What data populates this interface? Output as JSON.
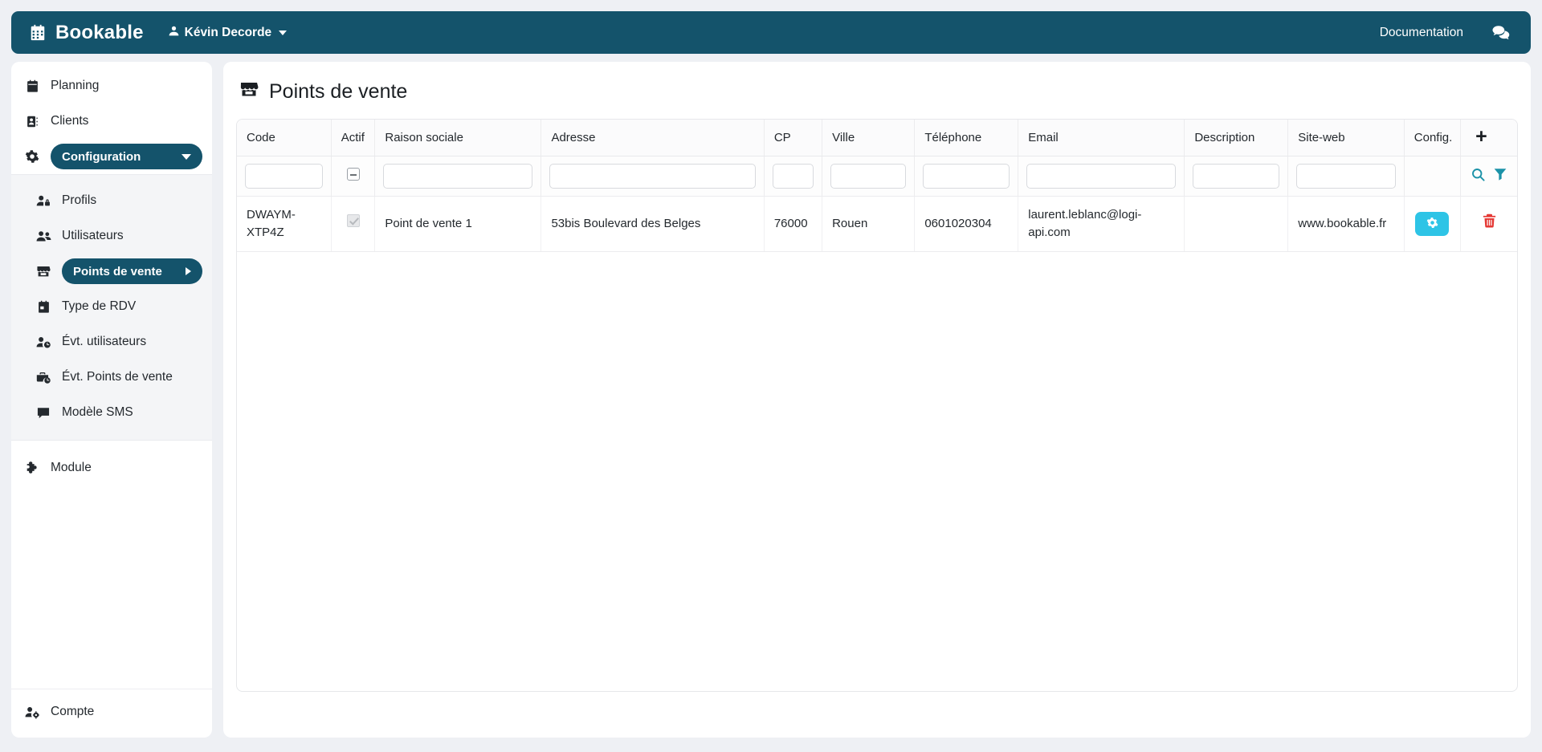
{
  "colors": {
    "brand_dark": "#14536b",
    "accent_cyan": "#2ec4e6",
    "danger_red": "#e53935",
    "page_bg": "#eef0f4",
    "tool_teal": "#1b92a8"
  },
  "navbar": {
    "brand": "Bookable",
    "brand_icon": "calendar-icon",
    "user_name": "Kévin Decorde",
    "user_icon": "user-icon",
    "caret_icon": "caret-down-icon",
    "documentation_label": "Documentation",
    "chat_icon": "chat-bubbles-icon"
  },
  "sidebar": {
    "top_items": [
      {
        "label": "Planning",
        "icon": "calendar-icon",
        "active": false
      },
      {
        "label": "Clients",
        "icon": "contact-card-icon",
        "active": false
      },
      {
        "label": "Configuration",
        "icon": "gear-icon",
        "active": true,
        "expanded": true
      }
    ],
    "submenu_items": [
      {
        "label": "Profils",
        "icon": "user-lock-icon",
        "active": false
      },
      {
        "label": "Utilisateurs",
        "icon": "users-icon",
        "active": false
      },
      {
        "label": "Points de vente",
        "icon": "store-icon",
        "active": true
      },
      {
        "label": "Type de RDV",
        "icon": "calendar-day-icon",
        "active": false
      },
      {
        "label": "Évt. utilisateurs",
        "icon": "user-clock-icon",
        "active": false
      },
      {
        "label": "Évt. Points de vente",
        "icon": "briefcase-clock-icon",
        "active": false
      },
      {
        "label": "Modèle SMS",
        "icon": "comment-icon",
        "active": false
      }
    ],
    "module_item": {
      "label": "Module",
      "icon": "puzzle-piece-icon"
    },
    "account_item": {
      "label": "Compte",
      "icon": "user-gear-icon"
    }
  },
  "main": {
    "page_title": "Points de vente",
    "page_title_icon": "store-icon",
    "table": {
      "columns": [
        "Code",
        "Actif",
        "Raison sociale",
        "Adresse",
        "CP",
        "Ville",
        "Téléphone",
        "Email",
        "Description",
        "Site-web",
        "Config."
      ],
      "add_icon": "plus-icon",
      "filters": {
        "code": "",
        "actif_state": "indeterminate",
        "raison_sociale": "",
        "adresse": "",
        "cp": "",
        "ville": "",
        "telephone": "",
        "email": "",
        "description": "",
        "site_web": "",
        "search_icon": "search-icon",
        "filter_icon": "funnel-icon"
      },
      "rows": [
        {
          "code": "DWAYM-XTP4Z",
          "actif": true,
          "actif_disabled": true,
          "raison_sociale": "Point de vente 1",
          "adresse": "53bis Boulevard des Belges",
          "cp": "76000",
          "ville": "Rouen",
          "telephone": "0601020304",
          "email": "laurent.leblanc@logi-api.com",
          "description": "",
          "site_web": "www.bookable.fr",
          "config_icon": "gear-icon",
          "delete_icon": "trash-icon"
        }
      ]
    }
  }
}
